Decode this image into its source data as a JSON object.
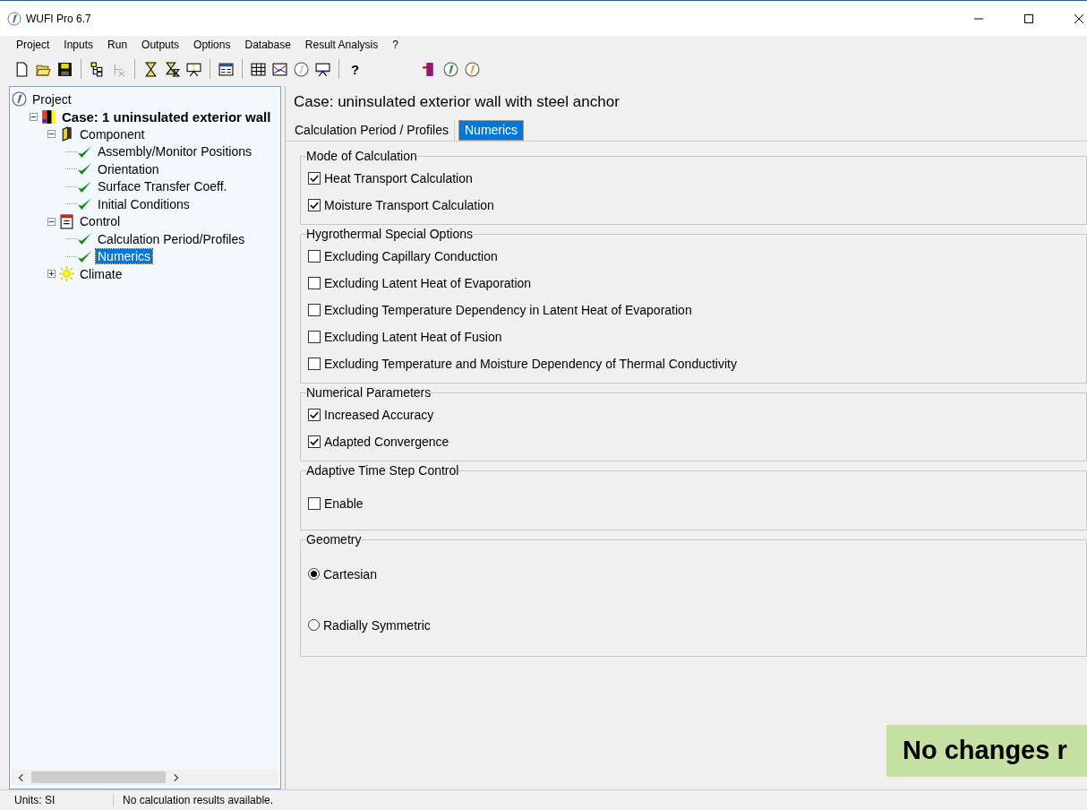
{
  "window": {
    "title": "WUFI Pro 6.7"
  },
  "menu": [
    "Project",
    "Inputs",
    "Run",
    "Outputs",
    "Options",
    "Database",
    "Result Analysis",
    "?"
  ],
  "toolbar": {
    "help_symbol": "?"
  },
  "tree": [
    {
      "label": "Project",
      "kind": "project",
      "selected": false,
      "children": [
        {
          "label": "Case: 1 uninsulated exterior wall",
          "kind": "case",
          "expanded": true,
          "selected": false,
          "children": [
            {
              "label": "Component",
              "kind": "component",
              "expanded": true,
              "selected": false,
              "children": [
                {
                  "label": "Assembly/Monitor Positions",
                  "kind": "check",
                  "selected": false
                },
                {
                  "label": "Orientation",
                  "kind": "check",
                  "selected": false
                },
                {
                  "label": "Surface Transfer Coeff.",
                  "kind": "check",
                  "selected": false
                },
                {
                  "label": "Initial Conditions",
                  "kind": "check",
                  "selected": false
                }
              ]
            },
            {
              "label": "Control",
              "kind": "control",
              "expanded": true,
              "selected": false,
              "children": [
                {
                  "label": "Calculation Period/Profiles",
                  "kind": "check",
                  "selected": false
                },
                {
                  "label": "Numerics",
                  "kind": "check",
                  "selected": true
                }
              ]
            },
            {
              "label": "Climate",
              "kind": "climate",
              "expanded": false,
              "selected": false
            }
          ]
        }
      ]
    }
  ],
  "case_title": "Case:  uninsulated exterior wall with steel anchor",
  "tabs": [
    {
      "label": "Calculation Period / Profiles",
      "selected": false
    },
    {
      "label": "Numerics",
      "selected": true
    }
  ],
  "groups": [
    {
      "title": "Mode of Calculation",
      "items": [
        {
          "kind": "checkbox",
          "label": "Heat Transport Calculation",
          "checked": true
        },
        {
          "kind": "checkbox",
          "label": "Moisture Transport Calculation",
          "checked": true
        }
      ]
    },
    {
      "title": "Hygrothermal Special Options",
      "items": [
        {
          "kind": "checkbox",
          "label": "Excluding Capillary Conduction",
          "checked": false
        },
        {
          "kind": "checkbox",
          "label": "Excluding Latent Heat of Evaporation",
          "checked": false
        },
        {
          "kind": "checkbox",
          "label": "Excluding Temperature Dependency in Latent Heat of Evaporation",
          "checked": false
        },
        {
          "kind": "checkbox",
          "label": "Excluding Latent Heat of Fusion",
          "checked": false
        },
        {
          "kind": "checkbox",
          "label": "Excluding Temperature and Moisture Dependency of Thermal Conductivity",
          "checked": false
        }
      ]
    },
    {
      "title": "Numerical Parameters",
      "items": [
        {
          "kind": "checkbox",
          "label": "Increased Accuracy",
          "checked": true
        },
        {
          "kind": "checkbox",
          "label": "Adapted Convergence",
          "checked": true
        }
      ]
    },
    {
      "title": "Adaptive Time Step Control",
      "items": [
        {
          "kind": "checkbox",
          "label": "Enable",
          "checked": false
        }
      ]
    },
    {
      "title": "Geometry",
      "items": [
        {
          "kind": "radio",
          "label": "Cartesian",
          "checked": true
        },
        {
          "kind": "radio",
          "label": "Radially Symmetric",
          "checked": false
        }
      ]
    }
  ],
  "banner": "No changes r",
  "status_bar": {
    "units": "Units: SI",
    "message": "No calculation results available."
  }
}
